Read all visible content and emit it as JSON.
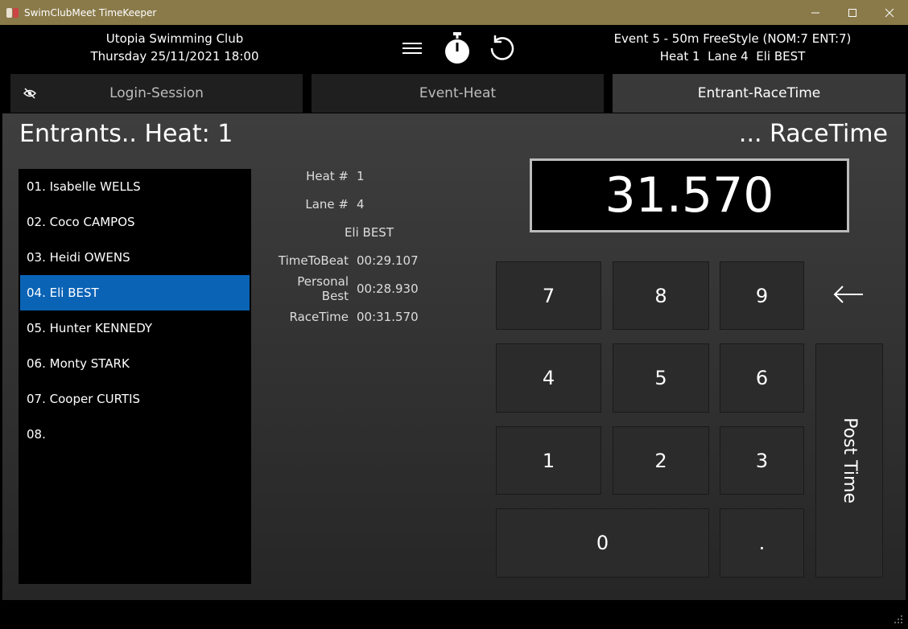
{
  "window": {
    "title": "SwimClubMeet TimeKeeper",
    "minimize_icon": "minimize-icon",
    "maximize_icon": "maximize-icon",
    "close_icon": "close-icon"
  },
  "header": {
    "club_name": "Utopia Swimming Club",
    "session_datetime": "Thursday 25/11/2021 18:00",
    "event_line": "Event 5 - 50m FreeStyle (NOM:7 ENT:7)",
    "heat_line": "Heat 1  Lane 4  Eli BEST",
    "icons": [
      "hamburger-menu-icon",
      "stopwatch-icon",
      "refresh-icon"
    ]
  },
  "tabs": [
    {
      "label": "Login-Session",
      "active": false
    },
    {
      "label": "Event-Heat",
      "active": false
    },
    {
      "label": "Entrant-RaceTime",
      "active": true
    }
  ],
  "main": {
    "left_heading": "Entrants.. Heat: 1",
    "right_heading": "... RaceTime",
    "entrants": [
      {
        "label": "01. Isabelle WELLS",
        "selected": false
      },
      {
        "label": "02. Coco CAMPOS",
        "selected": false
      },
      {
        "label": "03. Heidi OWENS",
        "selected": false
      },
      {
        "label": "04. Eli BEST",
        "selected": true
      },
      {
        "label": "05. Hunter KENNEDY",
        "selected": false
      },
      {
        "label": "06. Monty STARK",
        "selected": false
      },
      {
        "label": "07. Cooper CURTIS",
        "selected": false
      },
      {
        "label": "08.",
        "selected": false
      }
    ],
    "details": {
      "heat_label": "Heat #",
      "heat_value": "1",
      "lane_label": "Lane #",
      "lane_value": "4",
      "name": "Eli BEST",
      "ttb_label": "TimeToBeat",
      "ttb_value": "00:29.107",
      "pb_label": "Personal Best",
      "pb_value": "00:28.930",
      "rt_label": "RaceTime",
      "rt_value": "00:31.570"
    },
    "display_value": "31.570",
    "keypad": {
      "k7": "7",
      "k8": "8",
      "k9": "9",
      "k4": "4",
      "k5": "5",
      "k6": "6",
      "k1": "1",
      "k2": "2",
      "k3": "3",
      "k0": "0",
      "kdot": ".",
      "post_time": "Post Time",
      "backspace_icon": "backspace-arrow-icon"
    }
  }
}
